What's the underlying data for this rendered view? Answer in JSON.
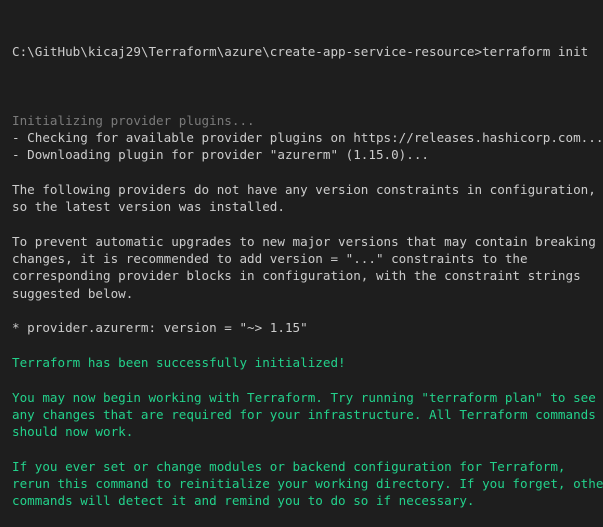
{
  "colors": {
    "background": "#1e1e1e",
    "default_text": "#cccccc",
    "dim_text": "#7a7a7a",
    "success_text": "#23d18b"
  },
  "terminal": {
    "prompt": "C:\\GitHub\\kicaj29\\Terraform\\azure\\create-app-service-resource>",
    "command": "terraform init",
    "lines": [
      {
        "text": "",
        "style": "blank"
      },
      {
        "text": "Initializing provider plugins...",
        "style": "dim"
      },
      {
        "text": "- Checking for available provider plugins on https://releases.hashicorp.com...",
        "style": "default"
      },
      {
        "text": "- Downloading plugin for provider \"azurerm\" (1.15.0)...",
        "style": "default"
      },
      {
        "text": "",
        "style": "blank"
      },
      {
        "text": "The following providers do not have any version constraints in configuration,",
        "style": "default"
      },
      {
        "text": "so the latest version was installed.",
        "style": "default"
      },
      {
        "text": "",
        "style": "blank"
      },
      {
        "text": "To prevent automatic upgrades to new major versions that may contain breaking",
        "style": "default"
      },
      {
        "text": "changes, it is recommended to add version = \"...\" constraints to the",
        "style": "default"
      },
      {
        "text": "corresponding provider blocks in configuration, with the constraint strings",
        "style": "default"
      },
      {
        "text": "suggested below.",
        "style": "default"
      },
      {
        "text": "",
        "style": "blank"
      },
      {
        "text": "* provider.azurerm: version = \"~> 1.15\"",
        "style": "default"
      },
      {
        "text": "",
        "style": "blank"
      },
      {
        "text": "Terraform has been successfully initialized!",
        "style": "green"
      },
      {
        "text": "",
        "style": "blank"
      },
      {
        "text": "You may now begin working with Terraform. Try running \"terraform plan\" to see",
        "style": "green"
      },
      {
        "text": "any changes that are required for your infrastructure. All Terraform commands",
        "style": "green"
      },
      {
        "text": "should now work.",
        "style": "green"
      },
      {
        "text": "",
        "style": "blank"
      },
      {
        "text": "If you ever set or change modules or backend configuration for Terraform,",
        "style": "green"
      },
      {
        "text": "rerun this command to reinitialize your working directory. If you forget, other",
        "style": "green"
      },
      {
        "text": "commands will detect it and remind you to do so if necessary.",
        "style": "green"
      }
    ]
  }
}
